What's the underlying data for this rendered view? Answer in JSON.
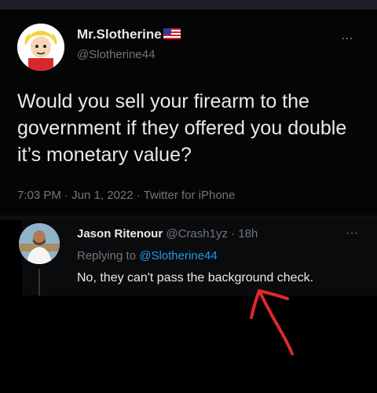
{
  "tweet": {
    "display_name": "Mr.Slotherine",
    "handle": "@Slotherine44",
    "text": "Would you sell your firearm to the government if they offered you double it’s monetary value?",
    "timestamp": "7:03 PM · Jun 1, 2022 · Twitter for iPhone",
    "more_label": "···"
  },
  "reply": {
    "display_name": "Jason Ritenour",
    "handle": "@Crash1yz",
    "time": "· 18h",
    "replying_prefix": "Replying to",
    "replying_to": "@Slotherine44",
    "text": "No, they can't pass the background check.",
    "more_label": "···"
  },
  "colors": {
    "background": "#000000",
    "text_primary": "#e7e9ea",
    "text_secondary": "#71767b",
    "link": "#1d9bf0",
    "annotation_arrow": "#e0282e"
  },
  "icons": [
    "us-flag-icon",
    "more-options-icon",
    "hand-drawn-arrow-icon"
  ]
}
